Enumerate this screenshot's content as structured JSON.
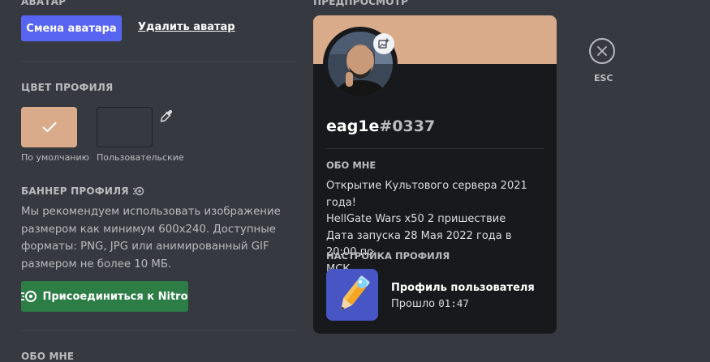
{
  "left": {
    "avatar_section": {
      "heading": "АВАТАР",
      "change_button": "Смена аватара",
      "remove_button": "Удалить аватар"
    },
    "profile_color": {
      "heading": "ЦВЕТ ПРОФИЛЯ",
      "default_label": "По умолчанию",
      "custom_label": "Пользовательские",
      "default_color": "#daab8b"
    },
    "banner": {
      "heading": "БАННЕР ПРОФИЛЯ",
      "description": "Мы рекомендуем использовать изображение размером как минимум 600x240. Доступные форматы: PNG, JPG или анимированный GIF размером не более 10 МБ.",
      "nitro_button": "Присоединиться к Nitro"
    },
    "about_heading_partial": "ОБО МНЕ"
  },
  "preview": {
    "heading": "ПРЕДПРОСМОТР",
    "banner_color": "#daab8b",
    "username": "eag1e",
    "discriminator": "#0337",
    "about_heading": "ОБО МНЕ",
    "about_text_lines": [
      "Открытие Культового сервера 2021 года!",
      "HellGate Wars x50 2 пришествие",
      "Дата запуска 28 Мая 2022 года в 20:00 по",
      "МСК"
    ],
    "activity_heading": "НАСТРОЙКА ПРОФИЛЯ",
    "activity_name": "Профиль пользователя",
    "activity_elapsed_prefix": "Прошло",
    "activity_elapsed_time": "01:47"
  },
  "close": {
    "label": "ESC"
  },
  "colors": {
    "background": "#36393f",
    "card": "#18191c",
    "brand": "#5865f2",
    "nitro_green": "#2d7d46"
  }
}
